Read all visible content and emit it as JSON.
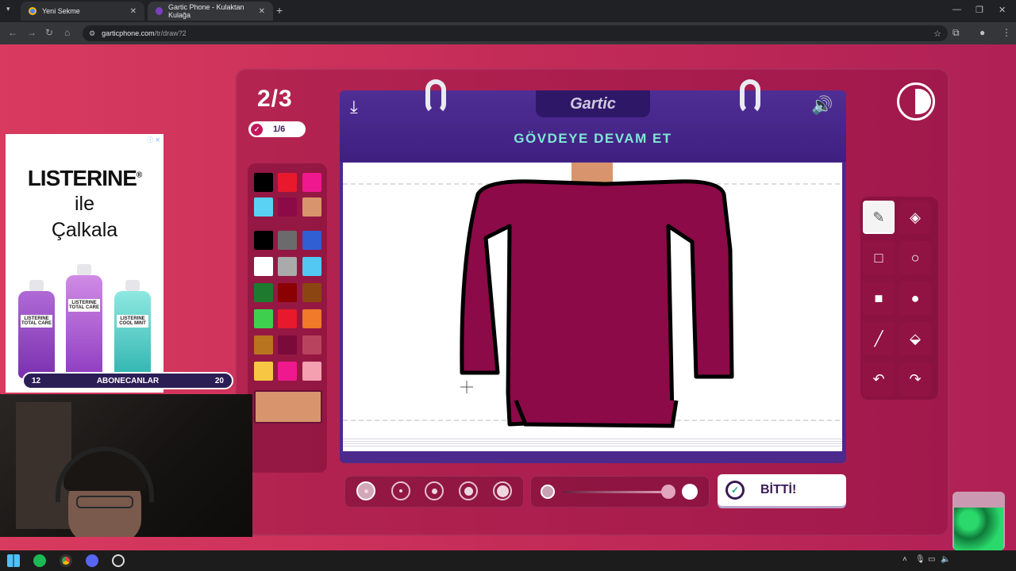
{
  "browser": {
    "tabs": [
      {
        "label": "Yeni Sekme"
      },
      {
        "label": "Gartic Phone - Kulaktan Kulağa"
      }
    ],
    "url_host": "garticphone.com",
    "url_path": "/tr/draw?2"
  },
  "game": {
    "round": "2/3",
    "progress": "1/6",
    "logo": "Gartic",
    "prompt": "GÖVDEYE DEVAM ET",
    "done_label": "BİTTİ!",
    "selected_tool": "pencil",
    "opacity_level": 0.85
  },
  "palette": {
    "colors": [
      "#000000",
      "#e8192c",
      "#f0188e",
      "#5ad2f4",
      "#8b0a47",
      "#d8956d",
      "#000000",
      "#6b6b6b",
      "#2f5fd3",
      "#ffffff",
      "#aaaaaa",
      "#53c8f2",
      "#1e7a2e",
      "#8b0000",
      "#8b4513",
      "#3fcf4f",
      "#e8192c",
      "#f07a2a",
      "#b8741f",
      "#7a0a3a",
      "#b8435e",
      "#f7c743",
      "#f0188e",
      "#f4a0b0"
    ],
    "selected_color": "#d8956d"
  },
  "tools": [
    {
      "name": "pencil"
    },
    {
      "name": "eraser"
    },
    {
      "name": "rectangle-outline"
    },
    {
      "name": "ellipse-outline"
    },
    {
      "name": "rectangle-filled"
    },
    {
      "name": "ellipse-filled"
    },
    {
      "name": "line"
    },
    {
      "name": "fill-bucket"
    },
    {
      "name": "undo"
    },
    {
      "name": "redo"
    }
  ],
  "ad": {
    "brand": "LISTERINE",
    "reg_mark": "®",
    "line1": "ile",
    "line2": "Çalkala",
    "bottles": [
      "LISTERINE TOTAL CARE",
      "LISTERINE TOTAL CARE",
      "LISTERINE COOL MINT"
    ]
  },
  "subscriber_bar": {
    "current": "12",
    "label": "ABONECANLAR",
    "goal": "20"
  },
  "colors": {
    "bg_accent": "#c42c58",
    "board": "#4b2a8c",
    "prompt_text": "#7fe7d3",
    "drawing_fill": "#8b0a47",
    "skin": "#d8956d"
  }
}
